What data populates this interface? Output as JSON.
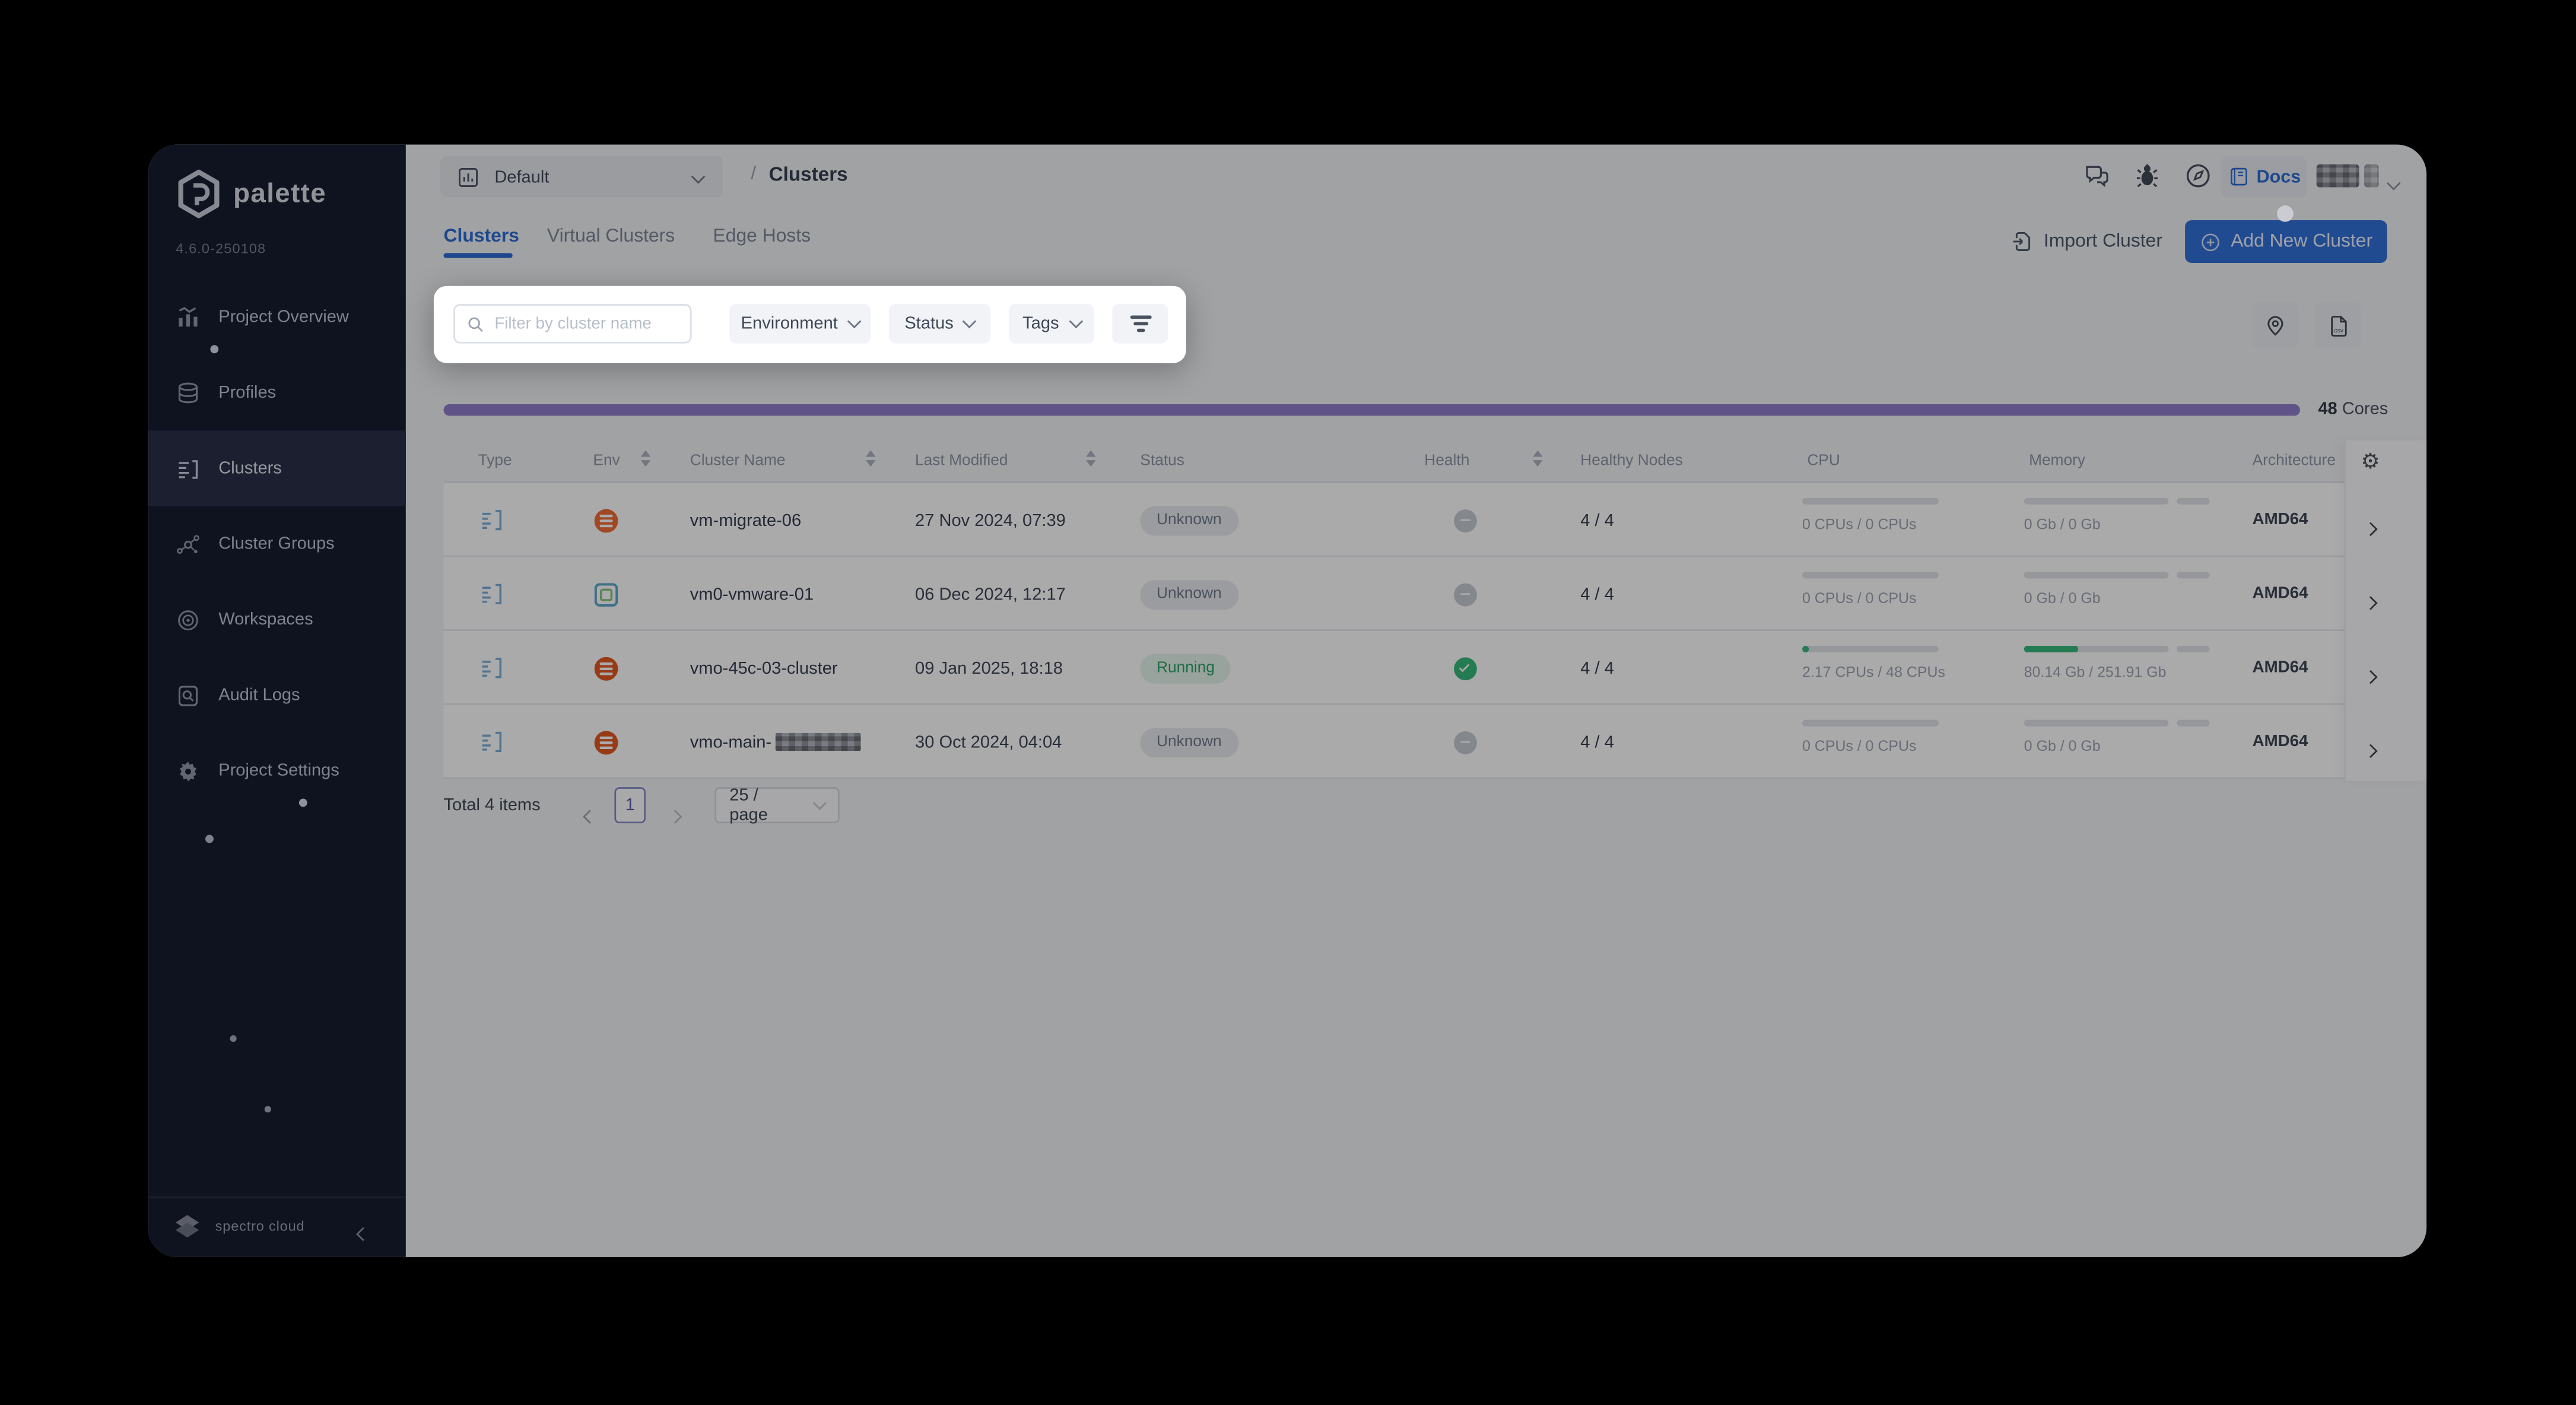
{
  "sidebar": {
    "brand": "palette",
    "version": "4.6.0-250108",
    "items": [
      "Project Overview",
      "Profiles",
      "Clusters",
      "Cluster Groups",
      "Workspaces",
      "Audit Logs",
      "Project Settings"
    ],
    "footer_brand": "spectro cloud"
  },
  "topbar": {
    "project": "Default",
    "separator": "/",
    "current": "Clusters",
    "docs": "Docs"
  },
  "tabs": [
    "Clusters",
    "Virtual Clusters",
    "Edge Hosts"
  ],
  "actions": {
    "import": "Import Cluster",
    "add": "Add New Cluster"
  },
  "filterbar": {
    "search_placeholder": "Filter by cluster name",
    "environment": "Environment",
    "status": "Status",
    "tags": "Tags"
  },
  "usage": {
    "value": "48",
    "unit": "Cores"
  },
  "table": {
    "columns": [
      "Type",
      "Env",
      "Cluster Name",
      "Last Modified",
      "Status",
      "Health",
      "Healthy Nodes",
      "CPU",
      "Memory",
      "Architecture"
    ],
    "rows": [
      {
        "name": "vm-migrate-06",
        "modified": "27 Nov 2024, 07:39",
        "status": "Unknown",
        "nodes": "4 / 4",
        "cpu": "0 CPUs / 0 CPUs",
        "memory": "0 Gb / 0 Gb",
        "arch": "AMD64"
      },
      {
        "name": "vm0-vmware-01",
        "modified": "06 Dec 2024, 12:17",
        "status": "Unknown",
        "nodes": "4 / 4",
        "cpu": "0 CPUs / 0 CPUs",
        "memory": "0 Gb / 0 Gb",
        "arch": "AMD64"
      },
      {
        "name": "vmo-45c-03-cluster",
        "modified": "09 Jan 2025, 18:18",
        "status": "Running",
        "nodes": "4 / 4",
        "cpu": "2.17 CPUs / 48 CPUs",
        "memory": "80.14 Gb / 251.91 Gb",
        "arch": "AMD64"
      },
      {
        "name": "vmo-main-",
        "modified": "30 Oct 2024, 04:04",
        "status": "Unknown",
        "nodes": "4 / 4",
        "cpu": "0 CPUs / 0 CPUs",
        "memory": "0 Gb / 0 Gb",
        "arch": "AMD64"
      }
    ]
  },
  "pagination": {
    "total": "Total 4 items",
    "page": "1",
    "page_size": "25 / page"
  },
  "icons": {
    "csv": "csv",
    "gear": "⚙"
  },
  "colors": {
    "accent": "#2f6fd6",
    "purple": "#8f7cc9",
    "green": "#36b878",
    "orange": "#f06a31"
  }
}
